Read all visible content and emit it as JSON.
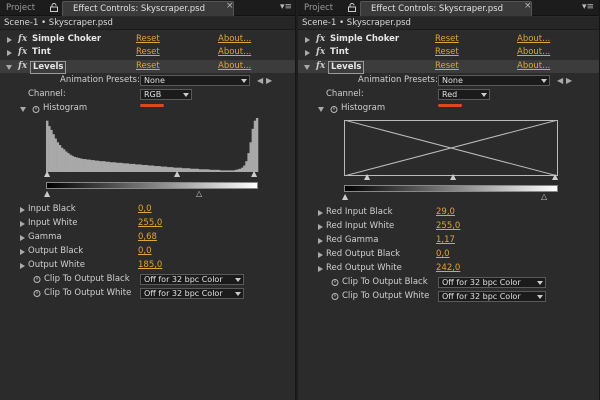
{
  "colors": {
    "accent": "#e0a534",
    "annotation": "#e0461d"
  },
  "left": {
    "tabs": {
      "project": "Project",
      "effect": "Effect Controls: Skyscraper.psd",
      "close": "×"
    },
    "breadcrumb": "Scene-1 • Skyscraper.psd",
    "effects": [
      {
        "fx": "fx",
        "name": "Simple Choker",
        "reset": "Reset",
        "about": "About..."
      },
      {
        "fx": "fx",
        "name": "Tint",
        "reset": "Reset",
        "about": "About..."
      },
      {
        "fx": "fx",
        "name": "Levels",
        "reset": "Reset",
        "about": "About..."
      }
    ],
    "presets_label": "Animation Presets:",
    "presets_value": "None",
    "channel_label": "Channel:",
    "channel_value": "RGB",
    "histogram_label": "Histogram",
    "histogram": {
      "type": "luminance-histogram",
      "levels": [
        0.95,
        0.85,
        0.78,
        0.7,
        0.62,
        0.55,
        0.5,
        0.45,
        0.42,
        0.38,
        0.35,
        0.32,
        0.3,
        0.28,
        0.27,
        0.26,
        0.25,
        0.24,
        0.24,
        0.23,
        0.23,
        0.22,
        0.22,
        0.21,
        0.21,
        0.2,
        0.2,
        0.2,
        0.19,
        0.19,
        0.18,
        0.18,
        0.18,
        0.17,
        0.17,
        0.17,
        0.16,
        0.16,
        0.16,
        0.15,
        0.15,
        0.15,
        0.14,
        0.14,
        0.14,
        0.13,
        0.13,
        0.13,
        0.12,
        0.12,
        0.12,
        0.11,
        0.11,
        0.11,
        0.1,
        0.1,
        0.1,
        0.09,
        0.09,
        0.09,
        0.08,
        0.08,
        0.08,
        0.08,
        0.07,
        0.07,
        0.07,
        0.07,
        0.06,
        0.06,
        0.06,
        0.06,
        0.05,
        0.05,
        0.05,
        0.05,
        0.05,
        0.04,
        0.04,
        0.04,
        0.04,
        0.04,
        0.03,
        0.03,
        0.03,
        0.03,
        0.03,
        0.03,
        0.03,
        0.04,
        0.05,
        0.06,
        0.08,
        0.12,
        0.2,
        0.35,
        0.55,
        0.8,
        0.95,
        1.0
      ]
    },
    "params": [
      {
        "label": "Input Black",
        "value": "0,0"
      },
      {
        "label": "Input White",
        "value": "255,0"
      },
      {
        "label": "Gamma",
        "value": "0,68"
      },
      {
        "label": "Output Black",
        "value": "0,0"
      },
      {
        "label": "Output White",
        "value": "185,0"
      }
    ],
    "clip": [
      {
        "label": "Clip To Output Black",
        "value": "Off for 32 bpc Color"
      },
      {
        "label": "Clip To Output White",
        "value": "Off for 32 bpc Color"
      }
    ]
  },
  "right": {
    "tabs": {
      "project": "Project",
      "effect": "Effect Controls: Skyscraper.psd",
      "close": "×"
    },
    "breadcrumb": "Scene-1 • Skyscraper.psd",
    "effects": [
      {
        "fx": "fx",
        "name": "Simple Choker",
        "reset": "Reset",
        "about": "About..."
      },
      {
        "fx": "fx",
        "name": "Tint",
        "reset": "Reset",
        "about": "About..."
      },
      {
        "fx": "fx",
        "name": "Levels",
        "reset": "Reset",
        "about": "About..."
      }
    ],
    "presets_label": "Animation Presets:",
    "presets_value": "None",
    "channel_label": "Channel:",
    "channel_value": "Red",
    "histogram_label": "Histogram",
    "params": [
      {
        "label": "Red Input Black",
        "value": "29,0"
      },
      {
        "label": "Red Input White",
        "value": "255,0"
      },
      {
        "label": "Red Gamma",
        "value": "1,17"
      },
      {
        "label": "Red Output Black",
        "value": "0,0"
      },
      {
        "label": "Red Output White",
        "value": "242,0"
      }
    ],
    "clip": [
      {
        "label": "Clip To Output Black",
        "value": "Off for 32 bpc Color"
      },
      {
        "label": "Clip To Output White",
        "value": "Off for 32 bpc Color"
      }
    ]
  }
}
